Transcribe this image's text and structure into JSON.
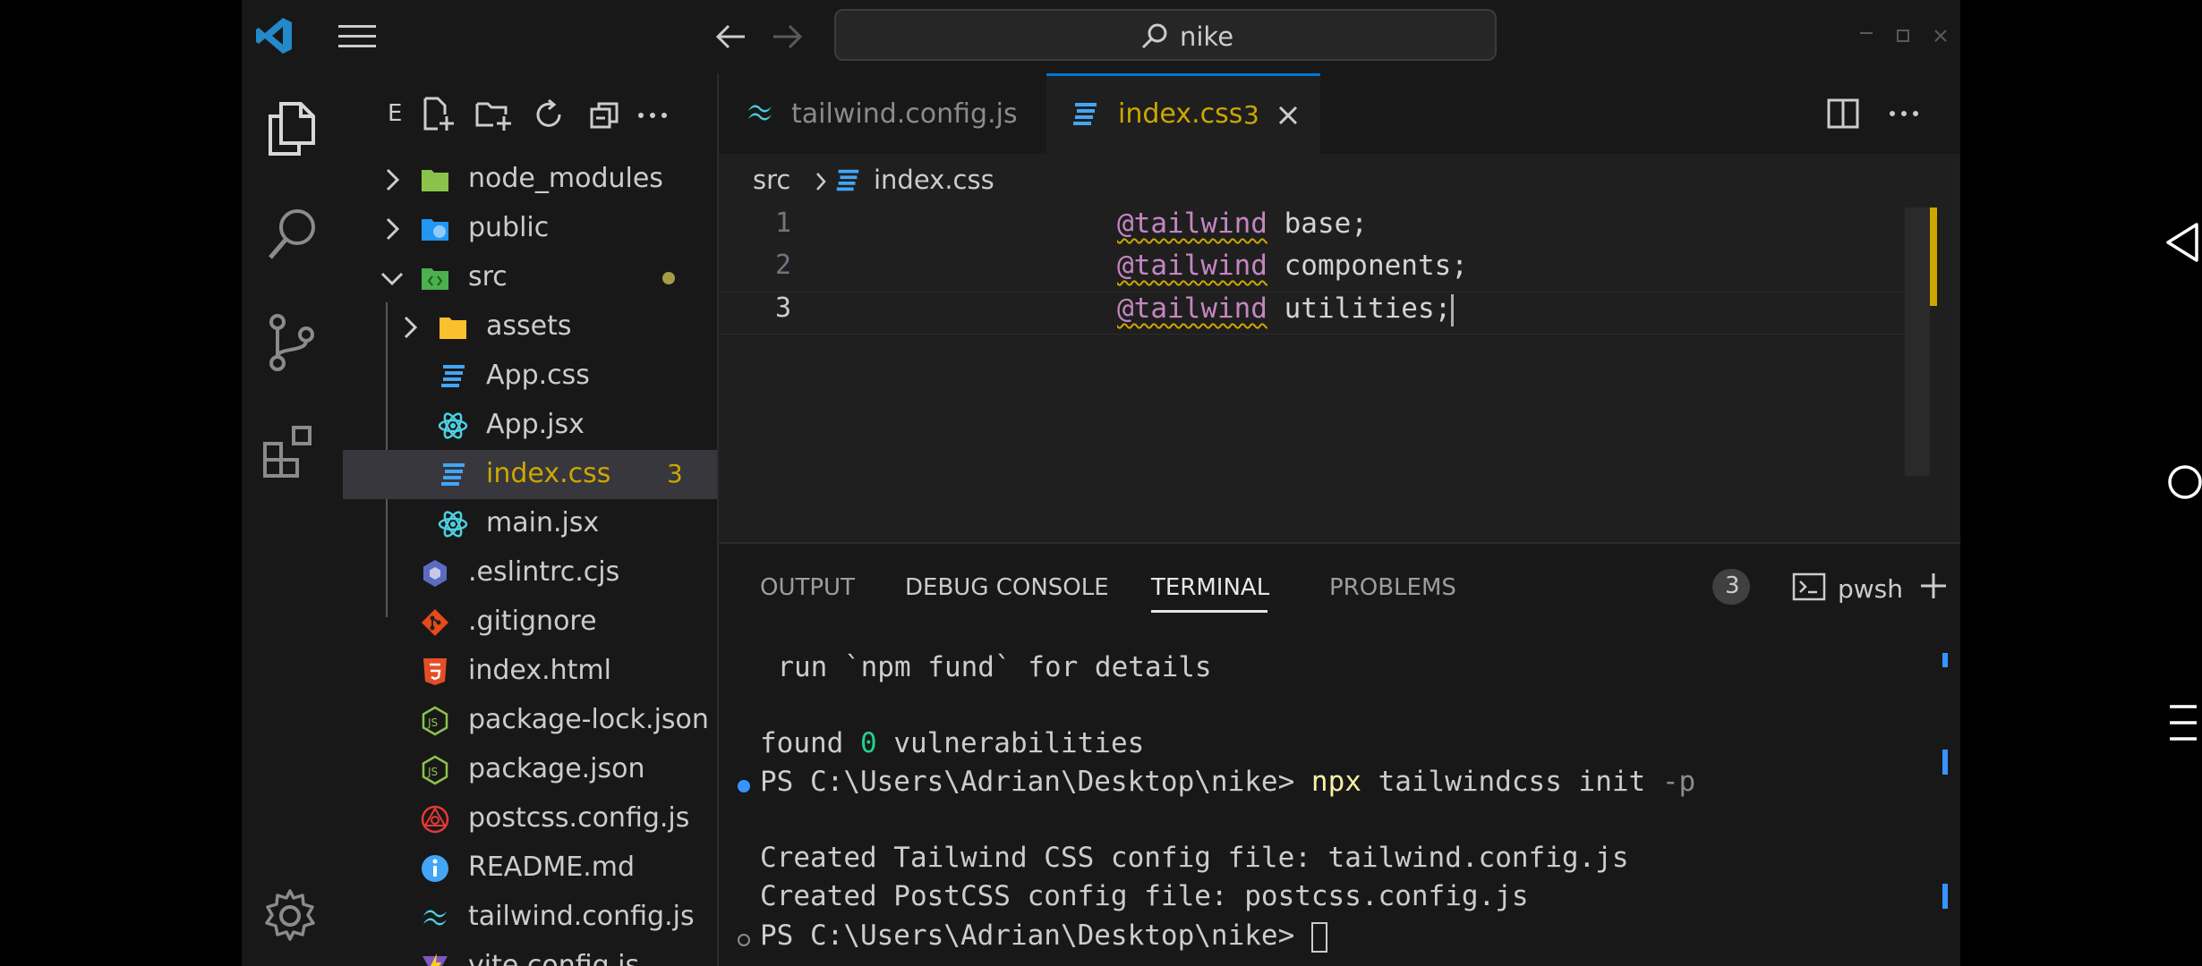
{
  "title_bar": {
    "search_text": "nike"
  },
  "explorer": {
    "title_initial": "E",
    "tree": [
      {
        "name": "node_modules",
        "icon": "folder-node-icon",
        "kind": "folder",
        "expanded": false
      },
      {
        "name": "public",
        "icon": "folder-public-icon",
        "kind": "folder",
        "expanded": false
      },
      {
        "name": "src",
        "icon": "folder-src-icon",
        "kind": "folder",
        "expanded": true
      },
      {
        "name": "assets",
        "icon": "folder-icon",
        "kind": "folder",
        "expanded": false
      },
      {
        "name": "App.css",
        "icon": "css-file-icon",
        "kind": "file"
      },
      {
        "name": "App.jsx",
        "icon": "react-file-icon",
        "kind": "file"
      },
      {
        "name": "index.css",
        "icon": "css-file-icon",
        "kind": "file",
        "badge": "3",
        "selected": true
      },
      {
        "name": "main.jsx",
        "icon": "react-file-icon",
        "kind": "file"
      },
      {
        "name": ".eslintrc.cjs",
        "icon": "eslint-file-icon",
        "kind": "file"
      },
      {
        "name": ".gitignore",
        "icon": "git-file-icon",
        "kind": "file"
      },
      {
        "name": "index.html",
        "icon": "html-file-icon",
        "kind": "file"
      },
      {
        "name": "package-lock.json",
        "icon": "node-json-icon",
        "kind": "file"
      },
      {
        "name": "package.json",
        "icon": "node-json-icon",
        "kind": "file"
      },
      {
        "name": "postcss.config.js",
        "icon": "postcss-file-icon",
        "kind": "file"
      },
      {
        "name": "README.md",
        "icon": "info-file-icon",
        "kind": "file"
      },
      {
        "name": "tailwind.config.js",
        "icon": "tailwind-file-icon",
        "kind": "file"
      },
      {
        "name": "vite.config.js",
        "icon": "vite-file-icon",
        "kind": "file"
      }
    ]
  },
  "editor": {
    "tabs": [
      {
        "label": "tailwind.config.js",
        "active": false
      },
      {
        "label": "index.css",
        "badge": "3",
        "active": true
      }
    ],
    "breadcrumb": {
      "folder": "src",
      "file": "index.css"
    },
    "lines": [
      {
        "num": "1",
        "keyword": "@tailwind",
        "rest": " base;"
      },
      {
        "num": "2",
        "keyword": "@tailwind",
        "rest": " components;"
      },
      {
        "num": "3",
        "keyword": "@tailwind",
        "rest": " utilities;"
      }
    ]
  },
  "panel": {
    "tabs": {
      "output": "OUTPUT",
      "debug": "DEBUG CONSOLE",
      "terminal": "TERMINAL",
      "problems": "PROBLEMS",
      "problems_count": "3"
    },
    "shell": "pwsh",
    "terminal": {
      "line1": "  run `npm fund` for details",
      "found_pre": "found ",
      "found_num": "0",
      "found_post": " vulnerabilities",
      "prompt1": "PS C:\\Users\\Adrian\\Desktop\\nike> ",
      "cmd_npx": "npx",
      "cmd_rest": " tailwindcss init ",
      "cmd_flag": "-p",
      "created1": "Created Tailwind CSS config file: tailwind.config.js",
      "created2": "Created PostCSS config file: postcss.config.js",
      "prompt2": "PS C:\\Users\\Adrian\\Desktop\\nike> "
    }
  },
  "colors": {
    "accent_blue": "#0078d4",
    "warning_yellow": "#cca700",
    "keyword_purple": "#c586c0",
    "terminal_yellow": "#f9f1a5",
    "terminal_green": "#23d18b"
  }
}
